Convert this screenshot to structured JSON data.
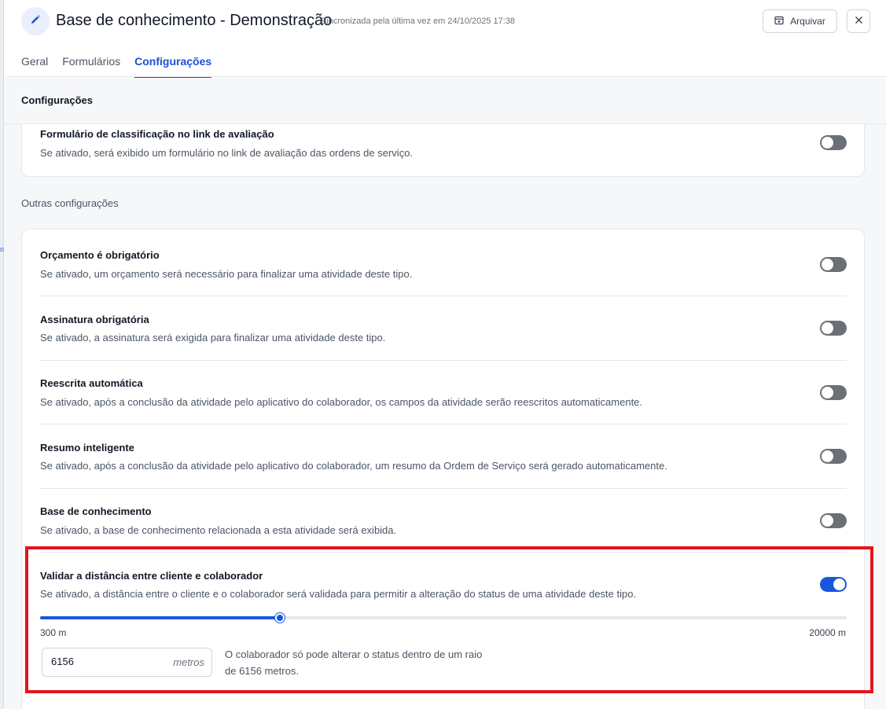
{
  "header": {
    "title": "Base de conhecimento - Demonstração",
    "sync_text": "Sincronizada pela última vez em 24/10/2025 17:38",
    "archive_label": "Arquivar"
  },
  "tabs": [
    {
      "label": "Geral",
      "active": false
    },
    {
      "label": "Formulários",
      "active": false
    },
    {
      "label": "Configurações",
      "active": true
    }
  ],
  "section_title": "Configurações",
  "top_setting": {
    "title": "Formulário de classificação no link de avaliação",
    "description": "Se ativado, será exibido um formulário no link de avaliação das ordens de serviço.",
    "enabled": false
  },
  "other_settings_label": "Outras configurações",
  "settings": [
    {
      "title": "Orçamento é obrigatório",
      "description": "Se ativado, um orçamento será necessário para finalizar uma atividade deste tipo.",
      "enabled": false
    },
    {
      "title": "Assinatura obrigatória",
      "description": "Se ativado, a assinatura será exigida para finalizar uma atividade deste tipo.",
      "enabled": false
    },
    {
      "title": "Reescrita automática",
      "description": "Se ativado, após a conclusão da atividade pelo aplicativo do colaborador, os campos da atividade serão reescritos automaticamente.",
      "enabled": false
    },
    {
      "title": "Resumo inteligente",
      "description": "Se ativado, após a conclusão da atividade pelo aplicativo do colaborador, um resumo da Ordem de Serviço será gerado automaticamente.",
      "enabled": false
    },
    {
      "title": "Base de conhecimento",
      "description": "Se ativado, a base de conhecimento relacionada a esta atividade será exibida.",
      "enabled": false
    },
    {
      "title": "Validar a distância entre cliente e colaborador",
      "description": "Se ativado, a distância entre o cliente e o colaborador será validada para permitir a alteração do status de uma atividade deste tipo.",
      "enabled": true
    }
  ],
  "distance": {
    "min_label": "300 m",
    "max_label": "20000 m",
    "min": 300,
    "max": 20000,
    "value": 6156,
    "value_text": "6156",
    "unit": "metros",
    "hint": "O colaborador só pode alterar o status dentro de um raio de 6156 metros."
  },
  "colors": {
    "accent": "#1a56db",
    "highlight": "#e3161c"
  }
}
